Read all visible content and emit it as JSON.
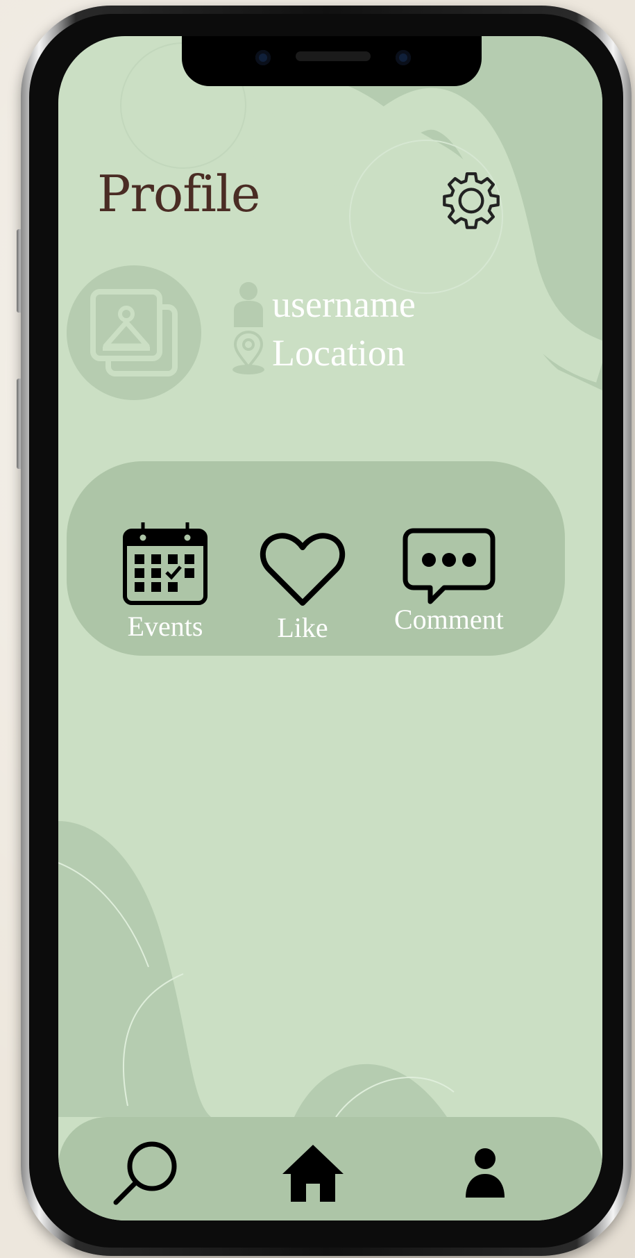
{
  "screen": {
    "title": "Profile",
    "settings_icon": "gear-icon"
  },
  "profile": {
    "avatar_icon": "image-placeholder-icon",
    "username": "username",
    "location": "Location",
    "user_icon": "person-icon",
    "location_icon": "map-pin-icon"
  },
  "actions": [
    {
      "label": "Events",
      "icon": "calendar-icon"
    },
    {
      "label": "Like",
      "icon": "heart-icon"
    },
    {
      "label": "Comment",
      "icon": "chat-bubble-icon"
    }
  ],
  "bottom_nav": [
    {
      "icon": "search-icon"
    },
    {
      "icon": "home-icon"
    },
    {
      "icon": "profile-icon"
    }
  ],
  "colors": {
    "screen_bg": "#cbdfc4",
    "card_bg": "#adc5a7",
    "title": "#4a2c24",
    "label": "#ffffff",
    "icon": "#000000"
  }
}
